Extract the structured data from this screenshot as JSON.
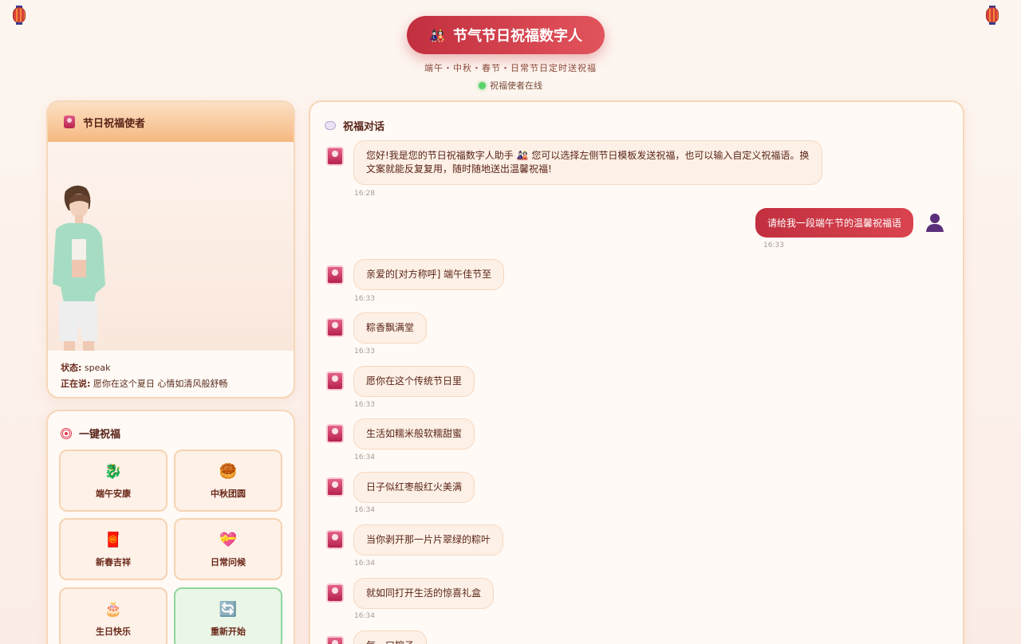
{
  "header": {
    "title": "节气节日祝福数字人",
    "title_icon": "🎎",
    "subtitle": "端午・中秋・春节・日常节日定时送祝福",
    "status": "祝福使者在线"
  },
  "avatar_panel": {
    "title": "节日祝福使者",
    "status_label": "状态:",
    "status_value": "speak",
    "speaking_label": "正在说:",
    "speaking_value": "愿你在这个夏日 心情如清风般舒畅"
  },
  "quick": {
    "title": "一键祝福",
    "buttons": [
      {
        "label": "端午安康",
        "icon": "🐉"
      },
      {
        "label": "中秋团圆",
        "icon": "🥮"
      },
      {
        "label": "新春吉祥",
        "icon": "🧧"
      },
      {
        "label": "日常问候",
        "icon": "💝"
      },
      {
        "label": "生日快乐",
        "icon": "🎂"
      },
      {
        "label": "重新开始",
        "icon": "🔄"
      }
    ]
  },
  "chat": {
    "title": "祝福对话",
    "intro": {
      "text": "您好!我是您的节日祝福数字人助手 🎎 您可以选择左侧节日模板发送祝福，也可以输入自定义祝福语。换文案就能反复复用，随时随地送出温馨祝福!",
      "time": "16:28"
    },
    "user": {
      "text": "请给我一段端午节的温馨祝福语",
      "time": "16:33"
    },
    "replies": [
      {
        "text": "亲爱的[对方称呼] 端午佳节至",
        "time": "16:33"
      },
      {
        "text": "粽香飘满堂",
        "time": "16:33"
      },
      {
        "text": "愿你在这个传统节日里",
        "time": "16:33"
      },
      {
        "text": "生活如糯米般软糯甜蜜",
        "time": "16:34"
      },
      {
        "text": "日子似红枣般红火美满",
        "time": "16:34"
      },
      {
        "text": "当你剥开那一片片翠绿的粽叶",
        "time": "16:34"
      },
      {
        "text": "就如同打开生活的惊喜礼盒",
        "time": "16:34"
      },
      {
        "text": "每一口粽子",
        "time": ""
      }
    ]
  },
  "colors": {
    "accent": "#c22f3f",
    "online": "#5bd36a"
  }
}
